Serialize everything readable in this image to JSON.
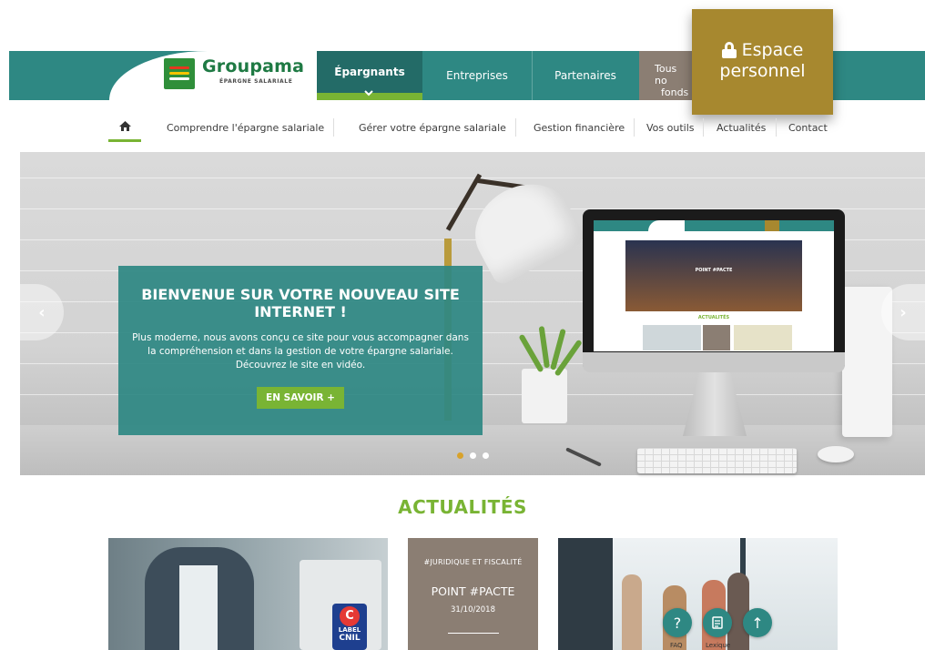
{
  "brand": {
    "name": "Groupama",
    "tagline": "ÉPARGNE SALARIALE"
  },
  "main_nav": {
    "tabs": [
      {
        "label": "Épargnants",
        "active": true
      },
      {
        "label": "Entreprises",
        "active": false
      },
      {
        "label": "Partenaires",
        "active": false
      }
    ],
    "tous_nos_fonds": {
      "line1": "Tous no",
      "line2": "fonds"
    }
  },
  "espace": {
    "line1": "Espace",
    "line2": "personnel",
    "icon": "lock-icon"
  },
  "sub_nav": {
    "home_icon": "home-icon",
    "items": [
      "Comprendre l'épargne salariale",
      "Gérer votre épargne salariale",
      "Gestion financière",
      "Vos outils",
      "Actualités",
      "Contact"
    ]
  },
  "hero": {
    "title": "BIENVENUE SUR VOTRE NOUVEAU SITE INTERNET !",
    "text": "Plus moderne, nous avons conçu ce site pour vous accompagner dans la compréhension et dans la gestion de votre épargne salariale. Découvrez le site en vidéo.",
    "button": "EN SAVOIR +",
    "prev_arrow": "‹",
    "next_arrow": "›",
    "slides": 3,
    "active_slide": 1,
    "monitor": {
      "screen_title": "POINT #PACTE",
      "screen_section": "ACTUALITÉS"
    }
  },
  "news": {
    "heading": "ACTUALITÉS",
    "card_center": {
      "tag": "#JURIDIQUE ET FISCALITÉ",
      "title": "POINT #PACTE",
      "date": "31/10/2018"
    },
    "card_left_badge": {
      "line1": "LABEL",
      "line2": "CNIL"
    }
  },
  "floating": {
    "help": {
      "symbol": "?",
      "label": "FAQ"
    },
    "doc": {
      "label": "Lexique"
    },
    "top": {
      "symbol": "↑"
    }
  },
  "colors": {
    "teal": "#2e8883",
    "teal_dark": "#236b67",
    "green": "#79b434",
    "gold": "#a7882f",
    "taupe": "#8b7e73"
  }
}
